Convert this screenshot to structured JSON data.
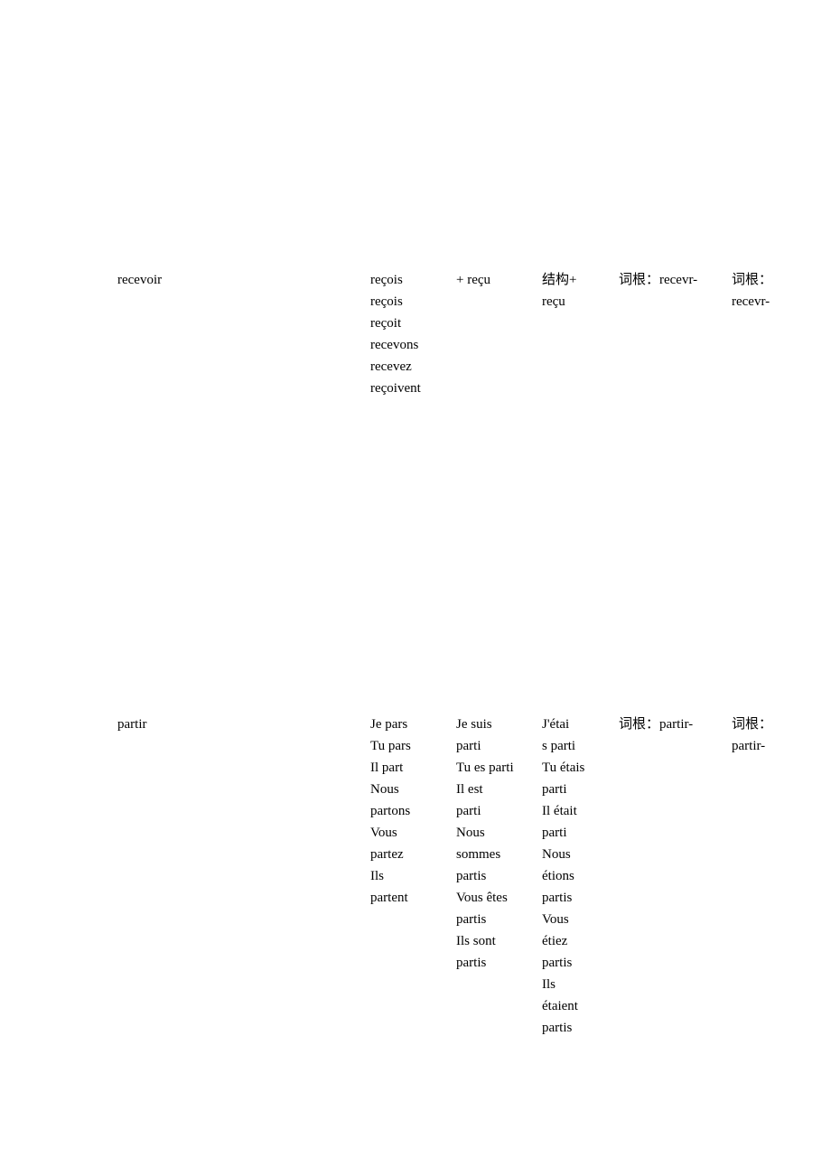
{
  "rows": [
    {
      "verb": "recevoir",
      "present": "  reçois\nreçois\nreçoit\nrecevons\nrecevez\nreçoivent",
      "passe": "+ reçu",
      "plus": "结构+\nreçu",
      "imparfait": "词根：recevr-",
      "futur": "词根：\nrecevr-"
    },
    {
      "verb": "partir",
      "present": "Je pars\nTu pars\nIl part\nNous\npartons\nVous\npartez\nIls\npartent",
      "passe": "  Je suis\nparti\nTu es parti\nIl est\nparti\nNous\nsommes\npartis\nVous êtes\npartis\nIls sont\npartis",
      "plus": " J'étai\ns parti\nTu étais\nparti\nIl était\nparti\nNous\nétions\npartis\nVous\nétiez\npartis\nIls\nétaient\npartis",
      "imparfait": "词根：partir-",
      "futur": "词根：\npartir-"
    }
  ]
}
